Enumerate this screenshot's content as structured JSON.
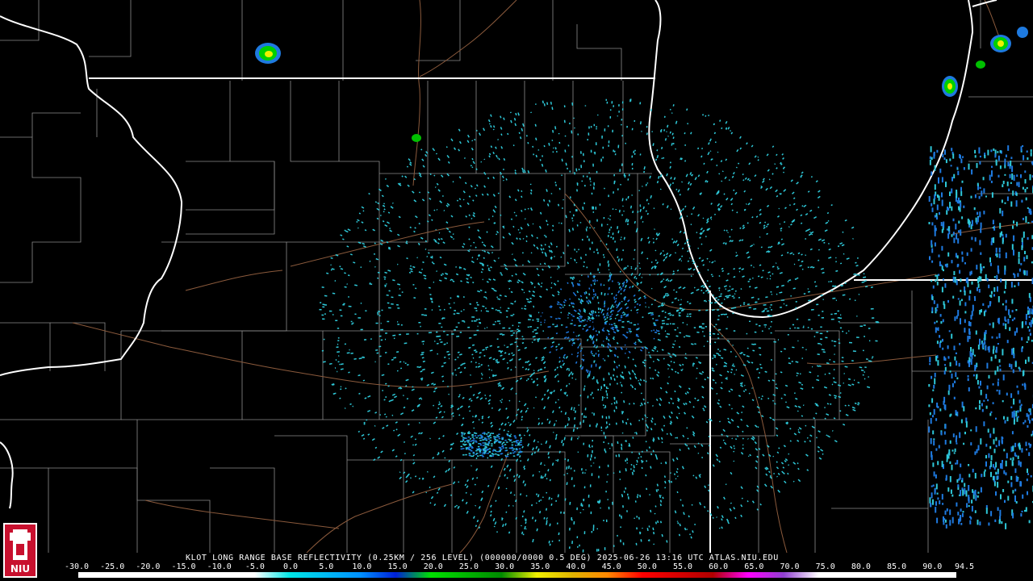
{
  "radar": {
    "title": "KLOT LONG RANGE BASE REFLECTIVITY (0.25KM / 256 LEVEL) (000000/0000 0.5 DEG) 2025-06-26 13:16 UTC  ATLAS.NIU.EDU",
    "logo_text": "NIU"
  },
  "legend": {
    "ticks": [
      "-30.0",
      "-25.0",
      "-20.0",
      "-15.0",
      "-10.0",
      "-5.0",
      "0.0",
      "5.0",
      "10.0",
      "15.0",
      "20.0",
      "25.0",
      "30.0",
      "35.0",
      "40.0",
      "45.0",
      "50.0",
      "55.0",
      "60.0",
      "65.0",
      "70.0",
      "75.0",
      "80.0",
      "85.0",
      "90.0",
      "94.5"
    ],
    "tick_values": [
      -30,
      -25,
      -20,
      -15,
      -10,
      -5,
      0,
      5,
      10,
      15,
      20,
      25,
      30,
      35,
      40,
      45,
      50,
      55,
      60,
      65,
      70,
      75,
      80,
      85,
      90,
      94.5
    ],
    "range": [
      -30,
      94.5
    ],
    "colors": [
      {
        "value": -30,
        "color": "#ffffff"
      },
      {
        "value": -5,
        "color": "#ffffff"
      },
      {
        "value": 0,
        "color": "#00e5e5"
      },
      {
        "value": 10,
        "color": "#0090ff"
      },
      {
        "value": 15,
        "color": "#0020d8"
      },
      {
        "value": 20,
        "color": "#00e000"
      },
      {
        "value": 30,
        "color": "#008a00"
      },
      {
        "value": 35,
        "color": "#f0f000"
      },
      {
        "value": 40,
        "color": "#e0b400"
      },
      {
        "value": 45,
        "color": "#ff8800"
      },
      {
        "value": 50,
        "color": "#ff0000"
      },
      {
        "value": 60,
        "color": "#b00000"
      },
      {
        "value": 65,
        "color": "#ff00ff"
      },
      {
        "value": 70,
        "color": "#9040d0"
      },
      {
        "value": 75,
        "color": "#ffffff"
      },
      {
        "value": 94.5,
        "color": "#ffffff"
      }
    ]
  },
  "colors": {
    "background": "#000000",
    "state_border": "#ffffff",
    "county_border": "#8c8c8c",
    "rivers_roads": "#8b5a3c",
    "echo_light": "#2ec8d8",
    "echo_medium": "#1e7ae0"
  }
}
